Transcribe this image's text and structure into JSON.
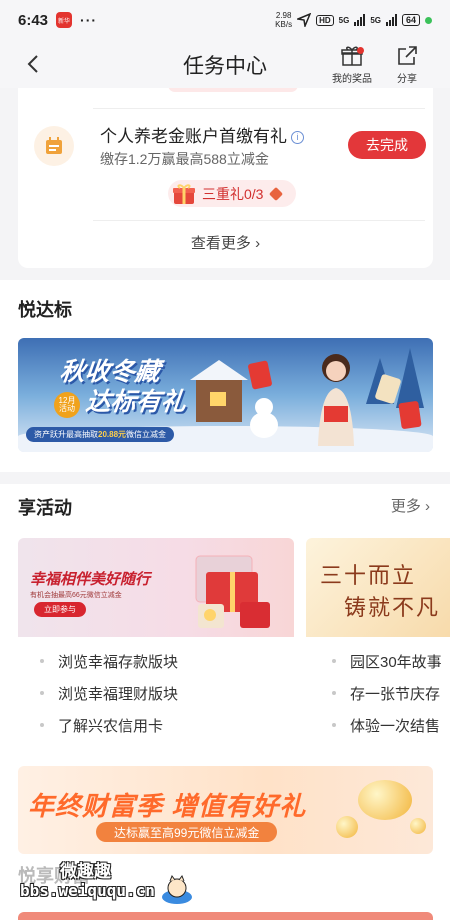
{
  "status_bar": {
    "time": "6:43",
    "app_badge": "新华",
    "more": "···",
    "speed_value": "2.98",
    "speed_unit": "KB/s",
    "hd": "HD",
    "net1": "5G",
    "net2": "5G",
    "battery": "64"
  },
  "header": {
    "title": "任务中心",
    "prize_label": "我的奖品",
    "share_label": "分享"
  },
  "task": {
    "title": "个人养老金账户首缴有礼",
    "subtitle": "缴存1.2万赢最高588立减金",
    "button": "去完成",
    "badge": "三重礼0/3",
    "more": "查看更多"
  },
  "yuedabiao": {
    "title": "悦达标",
    "banner": {
      "line1": "秋收冬藏",
      "line2": "达标有礼",
      "tag": "12月 活动",
      "sub_prefix": "资产跃升最高抽取",
      "sub_amount": "20.88元",
      "sub_suffix": "微信立减金"
    }
  },
  "activities": {
    "title": "享活动",
    "more": "更多",
    "cards": [
      {
        "img_title": "幸福相伴美好随行",
        "img_sub": "有机会抽最高66元微信立减金",
        "img_button": "立即参与",
        "items": [
          "浏览幸福存款版块",
          "浏览幸福理财版块",
          "了解兴农信用卡"
        ]
      },
      {
        "img_line1": "三十而立",
        "img_line2": "铸就不凡",
        "items": [
          "园区30年故事",
          "存一张节庆存",
          "体验一次结售"
        ]
      }
    ]
  },
  "banner2": {
    "title_a": "年终财富季",
    "title_b": "增值有好礼",
    "sub": "达标赢至高99元微信立减金"
  },
  "watermark": {
    "line1": "微趣趣",
    "line2": "bbs.weiququ.cn"
  },
  "peek_section": "悦享财富"
}
